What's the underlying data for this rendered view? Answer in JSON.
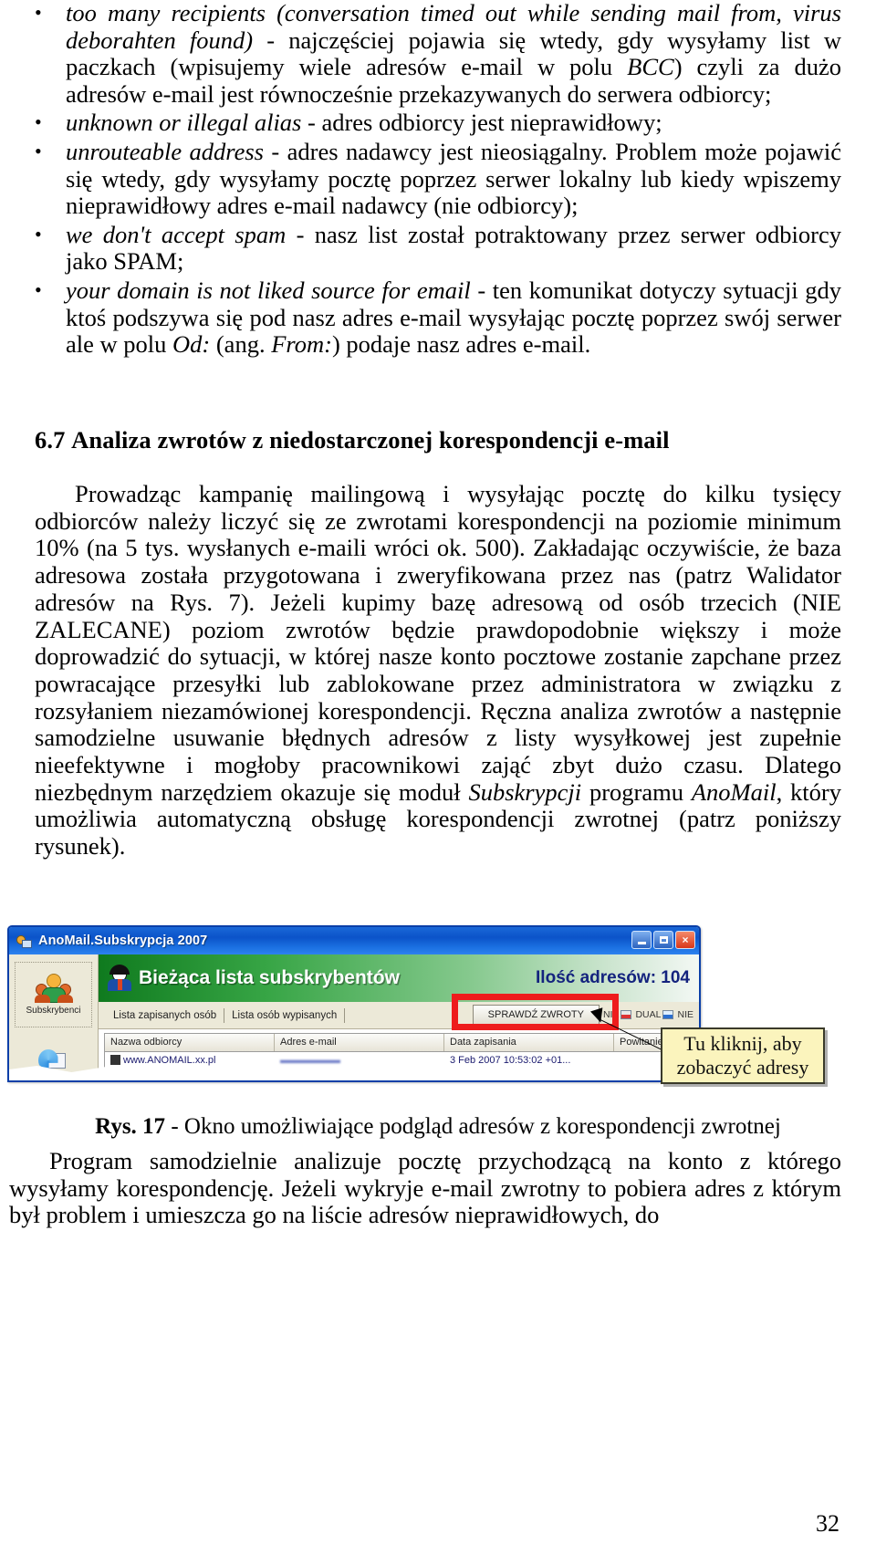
{
  "document": {
    "page_number": "32"
  },
  "bullets": [
    {
      "term": "too many recipients (conversation timed out while sending mail from, virus deborahten found)",
      "rest": " - najczęściej pojawia się wtedy, gdy wysyłamy list w paczkach (wpisujemy wiele adresów e-mail w polu ",
      "term2": "BCC",
      "rest2": ") czyli za dużo adresów e-mail jest równocześnie przekazywanych do serwera odbiorcy;"
    },
    {
      "term": "unknown or illegal alias",
      "rest": " - adres odbiorcy jest nieprawidłowy;"
    },
    {
      "term": "unrouteable address",
      "rest": " - adres nadawcy jest nieosiągalny. Problem może pojawić się wtedy, gdy wysyłamy pocztę poprzez serwer lokalny lub kiedy wpiszemy nieprawidłowy adres e-mail nadawcy (nie odbiorcy);"
    },
    {
      "term": "we don't accept spam",
      "rest": " - nasz list został potraktowany przez serwer odbiorcy jako SPAM;"
    },
    {
      "term": "your domain is not liked source for email",
      "rest": " - ten komunikat dotyczy sytuacji gdy ktoś podszywa się pod nasz adres e-mail wysyłając pocztę poprzez swój serwer ale w polu ",
      "term2": "Od:",
      "rest2": " (ang. ",
      "term3": "From:",
      "rest3": ") podaje nasz adres e-mail."
    }
  ],
  "section": {
    "number": "6.7",
    "title": "Analiza zwrotów z niedostarczonej korespondencji e-mail"
  },
  "paragraphs": {
    "intro_a": "Prowadząc kampanię mailingową i wysyłając pocztę do kilku tysięcy odbiorców należy liczyć się ze zwrotami korespondencji na poziomie minimum 10% (na 5 tys. wysłanych e-maili wróci ok. 500). Zakładając oczywiście, że baza adresowa została przygotowana i zweryfikowana przez nas (patrz Walidator adresów na Rys. 7). Jeżeli kupimy bazę adresową od osób trzecich (NIE ZALECANE) poziom zwrotów będzie prawdopodobnie większy i może doprowadzić do sytuacji, w której nasze konto pocztowe zostanie zapchane przez powracające przesyłki lub zablokowane przez administratora w związku z rozsyłaniem niezamówionej korespondencji. Ręczna analiza zwrotów a następnie samodzielne usuwanie błędnych adresów z listy wysyłkowej jest zupełnie nieefektywne i mogłoby pracownikowi zająć zbyt dużo czasu. Dlatego niezbędnym narzędziem okazuje się moduł ",
    "intro_italic1": "Subskrypcji",
    "intro_b": " programu ",
    "intro_italic2": "AnoMail",
    "intro_c": ", który umożliwia automatyczną obsługę korespondencji zwrotnej (patrz poniższy rysunek).",
    "after_fig": "Program samodzielnie analizuje pocztę przychodzącą na konto z którego wysyłamy korespondencję. Jeżeli wykryje e-mail zwrotny to pobiera adres z którym był problem i umieszcza go na liście adresów nieprawidłowych, do"
  },
  "figure": {
    "caption_label": "Rys. 17",
    "caption_text": " - Okno umożliwiające podgląd adresów z korespondencji zwrotnej",
    "app": {
      "window_title": "AnoMail.Subskrypcja 2007",
      "window_icon": "app-users-icon",
      "buttons": {
        "minimize": "minimize-icon",
        "maximize": "maximize-icon",
        "close": "×"
      },
      "sidebar": {
        "items": [
          {
            "label": "Subskrybenci",
            "icon": "people-group-icon"
          },
          {
            "label": "",
            "icon": "mail-refresh-icon"
          }
        ]
      },
      "banner": {
        "icon": "person-avatar-icon",
        "title": "Bieżąca lista subskrybentów",
        "counter": "Ilość adresów: 104"
      },
      "tabs": [
        {
          "label": "Lista zapisanych osób",
          "active": true
        },
        {
          "label": "Lista osób wypisanych",
          "active": false
        }
      ],
      "toolbar": {
        "check_returns_button": "SPRAWDŹ ZWROTY",
        "flag_items": [
          {
            "label": "NIE",
            "icon": "flag-icon"
          },
          {
            "label": "DUAL",
            "icon": "flag-icon"
          },
          {
            "label": "NIE",
            "icon": "flag-icon"
          }
        ]
      },
      "grid": {
        "columns": [
          "Nazwa odbiorcy",
          "Adres e-mail",
          "Data zapisania",
          "Powitanie"
        ],
        "rows": [
          {
            "name": "www.ANOMAIL.xx.pl",
            "email": "▬▬▬▬▬▬",
            "date": "3 Feb 2007 10:53:02 +01...",
            "greeting": ""
          }
        ]
      },
      "callout": {
        "line1": "Tu kliknij, aby",
        "line2": "zobaczyć adresy"
      },
      "highlight_color": "#ee1c1c"
    }
  }
}
